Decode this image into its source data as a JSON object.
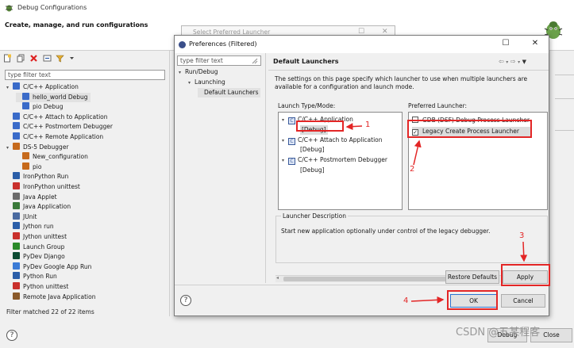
{
  "debug_configurations": {
    "title": "Debug Configurations",
    "subtitle": "Create, manage, and run configurations",
    "filter_placeholder": "type filter text",
    "tree": [
      {
        "label": "C/C++ Application",
        "level": 0,
        "expanded": true,
        "icon": "cpp-app-icon",
        "color": "#3a6bc9"
      },
      {
        "label": "hello_world Debug",
        "level": 1,
        "icon": "cpp-config-icon",
        "color": "#3a6bc9",
        "selected": true
      },
      {
        "label": "pio Debug",
        "level": 1,
        "icon": "cpp-config-icon",
        "color": "#3a6bc9"
      },
      {
        "label": "C/C++ Attach to Application",
        "level": 0,
        "icon": "cpp-attach-icon",
        "color": "#3a6bc9"
      },
      {
        "label": "C/C++ Postmortem Debugger",
        "level": 0,
        "icon": "cpp-postmortem-icon",
        "color": "#3a6bc9"
      },
      {
        "label": "C/C++ Remote Application",
        "level": 0,
        "icon": "cpp-remote-icon",
        "color": "#3a6bc9"
      },
      {
        "label": "DS-5 Debugger",
        "level": 0,
        "expanded": true,
        "icon": "ds5-icon",
        "color": "#c66a1c"
      },
      {
        "label": "New_configuration",
        "level": 1,
        "icon": "ds5-config-icon",
        "color": "#c66a1c"
      },
      {
        "label": "pio",
        "level": 1,
        "icon": "ds5-config-icon",
        "color": "#c66a1c"
      },
      {
        "label": "IronPython Run",
        "level": 0,
        "icon": "ironpython-run-icon",
        "color": "#2b5ea8"
      },
      {
        "label": "IronPython unittest",
        "level": 0,
        "icon": "ironpython-unittest-icon",
        "color": "#c9302c"
      },
      {
        "label": "Java Applet",
        "level": 0,
        "icon": "java-applet-icon",
        "color": "#6b6b6b"
      },
      {
        "label": "Java Application",
        "level": 0,
        "icon": "java-app-icon",
        "color": "#3a7a3a"
      },
      {
        "label": "JUnit",
        "level": 0,
        "icon": "junit-icon",
        "color": "#4a6aa0"
      },
      {
        "label": "Jython run",
        "level": 0,
        "icon": "jython-run-icon",
        "color": "#2b5ea8"
      },
      {
        "label": "Jython unittest",
        "level": 0,
        "icon": "jython-unittest-icon",
        "color": "#c9302c"
      },
      {
        "label": "Launch Group",
        "level": 0,
        "icon": "launch-group-icon",
        "color": "#2a8a2a"
      },
      {
        "label": "PyDev Django",
        "level": 0,
        "icon": "django-icon",
        "color": "#0c4b33"
      },
      {
        "label": "PyDev Google App Run",
        "level": 0,
        "icon": "google-app-icon",
        "color": "#3b7bd6"
      },
      {
        "label": "Python Run",
        "level": 0,
        "icon": "python-run-icon",
        "color": "#2b5ea8"
      },
      {
        "label": "Python unittest",
        "level": 0,
        "icon": "python-unittest-icon",
        "color": "#c9302c"
      },
      {
        "label": "Remote Java Application",
        "level": 0,
        "icon": "remote-java-icon",
        "color": "#8a5a2a"
      }
    ],
    "status": "Filter matched 22 of 22 items",
    "debug_label": "Debug",
    "close_label": "Close"
  },
  "select_preferred_launcher": {
    "title": "Select Preferred Launcher"
  },
  "preferences": {
    "title": "Preferences (Filtered)",
    "filter_placeholder": "type filter text",
    "tree": [
      {
        "label": "Run/Debug",
        "level": 0
      },
      {
        "label": "Launching",
        "level": 1
      },
      {
        "label": "Default Launchers",
        "level": 2,
        "selected": true
      }
    ],
    "page_title": "Default Launchers",
    "description": "The settings on this page specify which launcher to use when multiple launchers are available for a configuration and launch mode.",
    "launch_type_label": "Launch Type/Mode:",
    "launch_types": [
      {
        "label": "C/C++ Application",
        "level": 0
      },
      {
        "label": "[Debug]",
        "level": 1,
        "selected": true
      },
      {
        "label": "C/C++ Attach to Application",
        "level": 0
      },
      {
        "label": "[Debug]",
        "level": 1
      },
      {
        "label": "C/C++ Postmortem Debugger",
        "level": 0
      },
      {
        "label": "[Debug]",
        "level": 1
      }
    ],
    "preferred_launcher_label": "Preferred Launcher:",
    "launchers": [
      {
        "label": "GDB (DSF) Debug Process Launcher",
        "checked": false
      },
      {
        "label": "Legacy Create Process Launcher",
        "checked": true
      }
    ],
    "launcher_description_label": "Launcher Description",
    "launcher_description": "Start new application optionally under control of the legacy debugger.",
    "restore_defaults_label": "Restore Defaults",
    "apply_label": "Apply",
    "ok_label": "OK",
    "cancel_label": "Cancel"
  },
  "annotations": {
    "step1": "1",
    "step2": "2",
    "step3": "3",
    "step4": "4",
    "color": "#e32626"
  },
  "watermark": "CSDN @五某程客"
}
